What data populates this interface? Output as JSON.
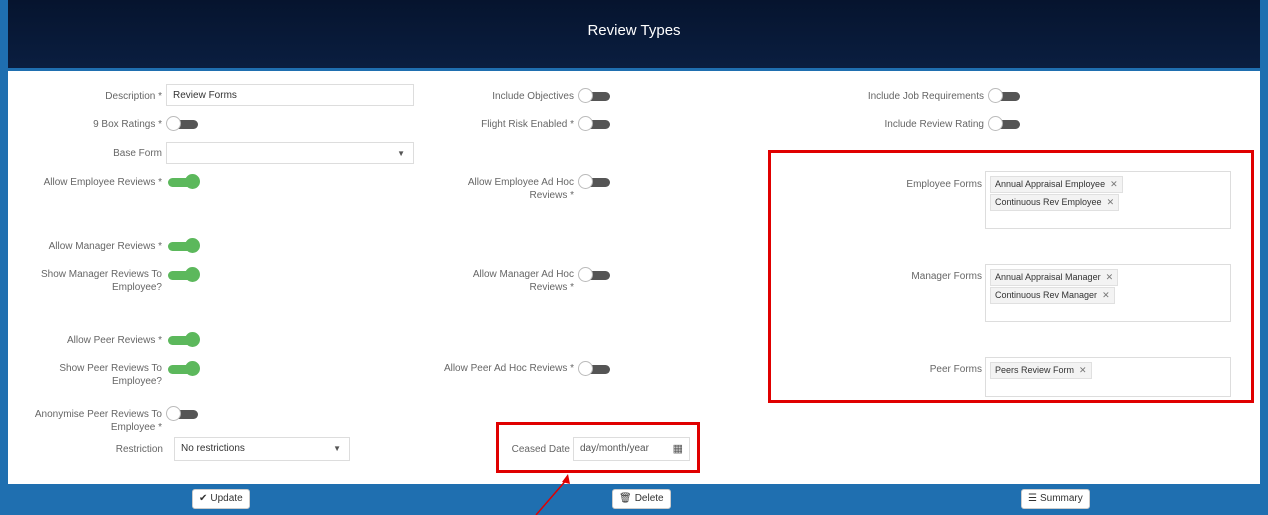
{
  "header": {
    "title": "Review Types"
  },
  "fields": {
    "description_label": "Description *",
    "description_value": "Review Forms",
    "nine_box_label": "9 Box Ratings *",
    "base_form_label": "Base Form",
    "allow_employee_reviews_label": "Allow Employee Reviews *",
    "allow_manager_reviews_label": "Allow Manager Reviews *",
    "show_manager_reviews_label": "Show Manager Reviews To Employee?",
    "allow_peer_reviews_label": "Allow Peer Reviews *",
    "show_peer_reviews_label": "Show Peer Reviews To Employee?",
    "anonymise_peer_label": "Anonymise Peer Reviews To Employee *",
    "restriction_label": "Restriction",
    "restriction_value": "No restrictions",
    "include_objectives_label": "Include Objectives",
    "flight_risk_label": "Flight Risk Enabled *",
    "allow_employee_adhoc_label": "Allow Employee Ad Hoc Reviews *",
    "allow_manager_adhoc_label": "Allow Manager Ad Hoc Reviews *",
    "allow_peer_adhoc_label": "Allow Peer Ad Hoc Reviews *",
    "ceased_date_label": "Ceased Date",
    "ceased_date_placeholder": "day/month/year",
    "include_job_req_label": "Include Job Requirements",
    "include_review_rating_label": "Include Review Rating"
  },
  "forms": {
    "employee_label": "Employee Forms",
    "employee_tags": [
      "Annual Appraisal Employee",
      "Continuous Rev Employee"
    ],
    "manager_label": "Manager Forms",
    "manager_tags": [
      "Annual Appraisal Manager",
      "Continuous Rev Manager"
    ],
    "peer_label": "Peer Forms",
    "peer_tags": [
      "Peers Review Form"
    ]
  },
  "toggles": {
    "nine_box": false,
    "allow_employee_reviews": true,
    "allow_manager_reviews": true,
    "show_manager_reviews": true,
    "allow_peer_reviews": true,
    "show_peer_reviews": true,
    "anonymise_peer": false,
    "include_objectives": false,
    "flight_risk": false,
    "allow_employee_adhoc": false,
    "allow_manager_adhoc": false,
    "allow_peer_adhoc": false,
    "include_job_req": false,
    "include_review_rating": false
  },
  "footer": {
    "update_label": "Update",
    "delete_label": "Delete",
    "summary_label": "Summary"
  },
  "colors": {
    "accent": "#1f6fb0",
    "toggle_on": "#5cb85c",
    "highlight": "#e00000",
    "header_bg": "#06142e"
  }
}
